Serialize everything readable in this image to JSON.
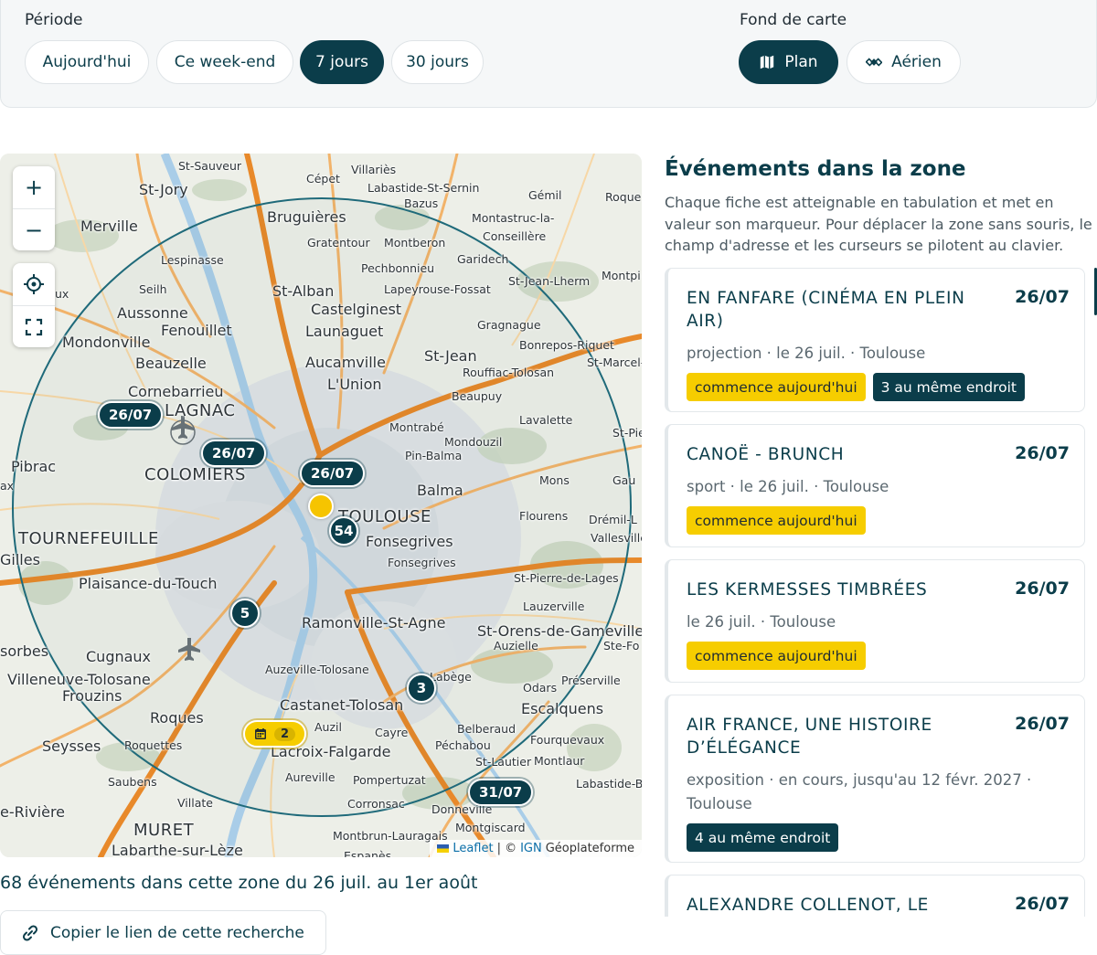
{
  "filters": {
    "period_label": "Période",
    "period_options": [
      "Aujourd'hui",
      "Ce week-end",
      "7 jours",
      "30 jours"
    ],
    "period_selected": "7 jours",
    "basemap_label": "Fond de carte",
    "basemap_options": [
      {
        "label": "Plan",
        "icon": "map-icon",
        "selected": true
      },
      {
        "label": "Aérien",
        "icon": "satellite-icon",
        "selected": false
      }
    ]
  },
  "map": {
    "controls": {
      "zoom_in": "+",
      "zoom_out": "−"
    },
    "clusters": {
      "c1": "26/07",
      "c2": "26/07",
      "c3": "26/07",
      "c4": "54",
      "c5": "5",
      "c6": "3",
      "c7": "2",
      "c8": "31/07"
    },
    "places": {
      "p01": "St-Sauveur",
      "p02": "Cépet",
      "p03": "Villariès",
      "p04": "St-Jory",
      "p05": "Labastide-St-Sernin",
      "p06": "Bazus",
      "p07": "Gémil",
      "p08": "Roque",
      "p09": "Merville",
      "p10": "Bruguières",
      "p11": "Montastruc-la-",
      "p12": "Conseillère",
      "p13": "Gratentour",
      "p14": "Montberon",
      "p15": "Lespinasse",
      "p16": "Garidech",
      "p17": "Pechbonnieu",
      "p18": "Seilh",
      "p19": "St-Alban",
      "p20": "Lapeyrouse-Fossat",
      "p21": "St-Jean-Lherm",
      "p22": "Montpi",
      "p23": "Aussonne",
      "p24": "Castelginest",
      "p25": "Fenouillet",
      "p26": "Launaguet",
      "p27": "Gragnague",
      "p28": "Mondonville",
      "p29": "Bonrepos-Riquet",
      "p30": "Beauzelle",
      "p31": "Aucamville",
      "p32": "St-Jean",
      "p33": "St-Marcel-",
      "p34": "L'Union",
      "p35": "Rouffiac-Tolosan",
      "p36": "Cornebarrieu",
      "p37": "Beaupuy",
      "p38": "LAGNAC",
      "p39": "Lavalette",
      "p40": "Montrabé",
      "p41": "Mondouzil",
      "p42": "St-Pie",
      "p43": "Pin-Balma",
      "p44": "Pibrac",
      "p45": "COLOMIERS",
      "p46": "Mons",
      "p47": "Gau",
      "p48": "Balma",
      "p49": "TOULOUSE",
      "p50": "Flourens",
      "p51": "Drémil-L",
      "p52": "Vallesville",
      "p53": "TOURNEFEUILLE",
      "p54": "Fonsegrives",
      "p55": "Fonsegrives",
      "p56": "Gilles",
      "p57": "St-Pierre-de-Lages",
      "p58": "Plaisance-du-Touch",
      "p59": "Lauzerville",
      "p60": "Ramonville-St-Agne",
      "p61": "St-Orens-de-Gameville",
      "p62": "Auzielle",
      "p63": "Ste-Fo",
      "p64": "sorbes",
      "p65": "Cugnaux",
      "p66": "Auzeville-Tolosane",
      "p67": "Labège",
      "p68": "Odars",
      "p69": "Préserville",
      "p70": "Villeneuve-Tolosane",
      "p71": "Frouzins",
      "p72": "Castanet-Tolosan",
      "p73": "Escalquens",
      "p74": "Roques",
      "p75": "Auzil",
      "p76": "Belberaud",
      "p77": "Cayre",
      "p78": "Fourquevaux",
      "p79": "Seysses",
      "p80": "Roquettes",
      "p81": "Lacroix-Falgarde",
      "p82": "Péchabou",
      "p83": "St-Lautier",
      "p84": "Montlaur",
      "p85": "Saubens",
      "p86": "Aureville",
      "p87": "Pompertuzat",
      "p88": "Labastide-B",
      "p89": "Villate",
      "p90": "Corronsac",
      "p91": "Donneville",
      "p92": "e-Rivière",
      "p93": "MURET",
      "p94": "Montgiscard",
      "p95": "Labarthe-sur-Lèze",
      "p96": "Montbrun-Lauragais",
      "p97": "Espanès",
      "p98": "ax",
      "p99": "ux"
    },
    "attribution": {
      "leaflet": "Leaflet",
      "sep": "| ©",
      "ign": "IGN",
      "geo": "Géoplateforme"
    }
  },
  "summary": "68 événements dans cette zone du 26 juil. au 1er août",
  "copy_button": "Copier le lien de cette recherche",
  "panel": {
    "title": "Événements dans la zone",
    "description": "Chaque fiche est atteignable en tabulation et met en valeur son marqueur. Pour déplacer la zone sans souris, le champ d'adresse et les curseurs se pilotent au clavier."
  },
  "events": [
    {
      "title": "EN FANFARE (CINÉMA EN PLEIN AIR)",
      "date": "26/07",
      "meta": "projection · le 26 juil. · Toulouse",
      "badge_yellow": "commence aujourd'hui",
      "badge_dark": "3 au même endroit"
    },
    {
      "title": "CANOË - BRUNCH",
      "date": "26/07",
      "meta": "sport · le 26 juil. · Toulouse",
      "badge_yellow": "commence aujourd'hui"
    },
    {
      "title": "LES KERMESSES TIMBRÉES",
      "date": "26/07",
      "meta": "le 26 juil. · Toulouse",
      "badge_yellow": "commence aujourd'hui"
    },
    {
      "title": "AIR FRANCE, UNE HISTOIRE D’ÉLÉGANCE",
      "date": "26/07",
      "meta": "exposition · en cours, jusqu'au 12 févr. 2027 · Toulouse",
      "badge_dark": "4 au même endroit"
    },
    {
      "title": "ALEXANDRE COLLENOT, LE",
      "date": "26/07"
    }
  ],
  "colors": {
    "accent": "#0b3d4a",
    "highlight": "#f6cd00",
    "road": "#e8892a"
  }
}
